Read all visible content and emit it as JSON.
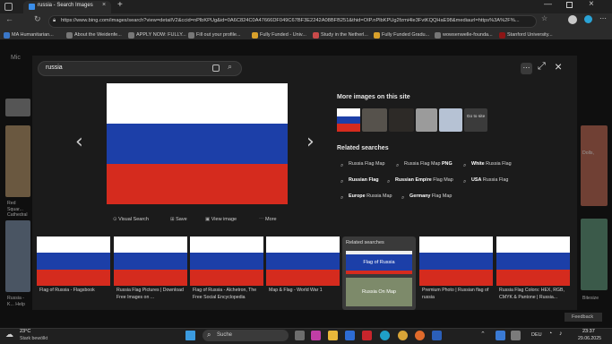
{
  "browser": {
    "tab_title": "russia - Search Images",
    "url": "https://www.bing.com/images/search?view=detailV2&ccid=nPlbKPUg&id=0A6C824C0A47666DF049C67BF3E2242A08BFB251&thid=OIP.nPlbKPUg2fzmi4le3FvtKQQHaE98&mediaurl=https%3A%2F%...",
    "bookmarks": [
      "MA Humanitarian...",
      "About the Weidenfe...",
      "APPLY NOW: FULLY...",
      "Fill out your profile...",
      "Fully Funded - Univ...",
      "Study in the Netherl...",
      "Fully Funded Gradu...",
      "wowsenwelle-founda...",
      "Stanford University..."
    ]
  },
  "search": {
    "query": "russia"
  },
  "actions": {
    "visual_search": "Visual Search",
    "save": "Save",
    "view_image": "View image",
    "more": "More"
  },
  "sidebar": {
    "more_images_title": "More images on this site",
    "go_to_site": "Go to site",
    "related_title": "Related searches",
    "related": [
      [
        "Russia Flag Map",
        "Russia Flag Map PNG",
        "White Russia Flag"
      ],
      [
        "Russian Flag",
        "Russian Empire Flag Map",
        "USA Russia Flag"
      ],
      [
        "Europe Russia Map",
        "Germany Flag Map"
      ]
    ]
  },
  "thumbs": [
    {
      "caption": "Flag of Russia - Flagsbook"
    },
    {
      "caption": "Russia Flag Pictures | Download Free Images on ..."
    },
    {
      "caption": "Flag of Russia - Alchetron, The Free Social Encyclopedia"
    },
    {
      "caption": "Map & Flag - World War 1"
    },
    {
      "caption": "Premium Photo | Russian flag of russia"
    },
    {
      "caption": "Russia Flag Colors: HEX, RGB, CMYK & Pantone | Russia..."
    }
  ],
  "related_panel": {
    "title": "Related searches",
    "item1": "Flag of Russia",
    "item2": "Russia On Map"
  },
  "background_left": {
    "cap1": "Red Squar... Cathedral",
    "cap2": "Russia - K... Help"
  },
  "background_right": {
    "cap1": "Dolls,",
    "cap2": "Bitesize"
  },
  "feedback": "Feedback",
  "taskbar": {
    "weather_temp": "23°C",
    "weather_desc": "Stark bewölkt",
    "search_placeholder": "Suche",
    "lang": "DEU",
    "time": "23:37",
    "date": "29.06.2025"
  },
  "colors": {
    "flag_white": "#ffffff",
    "flag_blue": "#1c3fa8",
    "flag_red": "#d52b1e"
  }
}
